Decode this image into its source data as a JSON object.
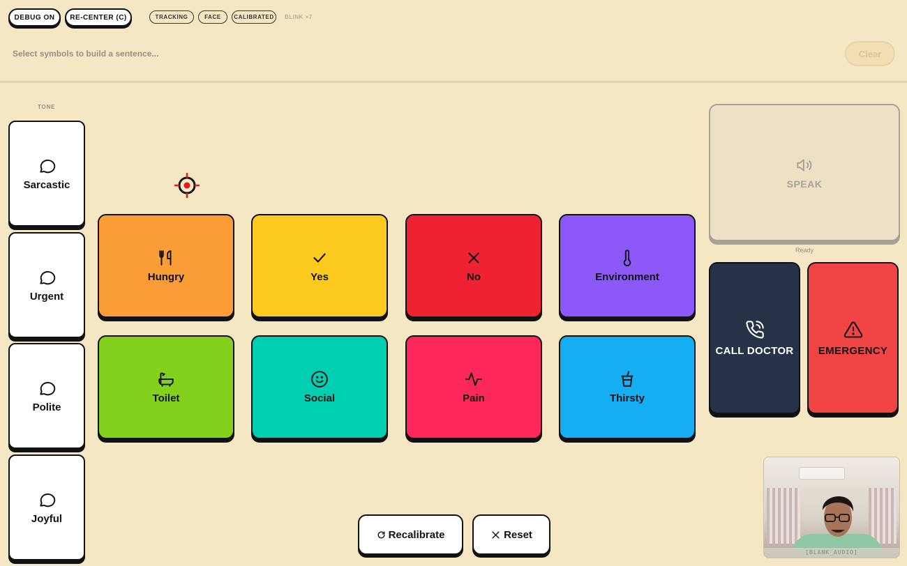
{
  "toolbar": {
    "debug_label": "DEBUG ON",
    "recenter_label": "RE-CENTER (C)",
    "status": [
      "TRACKING",
      "FACE",
      "CALIBRATED"
    ],
    "blink": "BLINK ×7"
  },
  "sentence": {
    "placeholder": "Select symbols to build a sentence...",
    "clear_label": "Clear"
  },
  "tone": {
    "header": "TONE",
    "items": [
      {
        "label": "Sarcastic",
        "icon": "speech-bubble-icon"
      },
      {
        "label": "Urgent",
        "icon": "speech-bubble-icon"
      },
      {
        "label": "Polite",
        "icon": "speech-bubble-icon"
      },
      {
        "label": "Joyful",
        "icon": "speech-bubble-icon"
      }
    ]
  },
  "symbols": [
    {
      "label": "Hungry",
      "icon": "fork-knife-icon",
      "color": "#fb9d36"
    },
    {
      "label": "Yes",
      "icon": "check-icon",
      "color": "#fdcb1f"
    },
    {
      "label": "No",
      "icon": "x-icon",
      "color": "#ef2233"
    },
    {
      "label": "Environment",
      "icon": "thermometer-icon",
      "color": "#8b59f7"
    },
    {
      "label": "Toilet",
      "icon": "bathtub-icon",
      "color": "#84d11c"
    },
    {
      "label": "Social",
      "icon": "smile-icon",
      "color": "#00ceb0"
    },
    {
      "label": "Pain",
      "icon": "pulse-icon",
      "color": "#fe2759"
    },
    {
      "label": "Thirsty",
      "icon": "cup-icon",
      "color": "#16aef2"
    }
  ],
  "speak": {
    "label": "SPEAK",
    "status": "Ready",
    "icon": "speaker-icon"
  },
  "call_doctor": {
    "label": "CALL DOCTOR",
    "color": "#263346",
    "icon": "phone-icon"
  },
  "emergency": {
    "label": "EMERGENCY",
    "color": "#f14545",
    "icon": "warning-icon"
  },
  "bottom": {
    "recalibrate_label": "Recalibrate",
    "reset_label": "Reset"
  },
  "webcam": {
    "caption": "[BLANK_AUDIO]"
  }
}
